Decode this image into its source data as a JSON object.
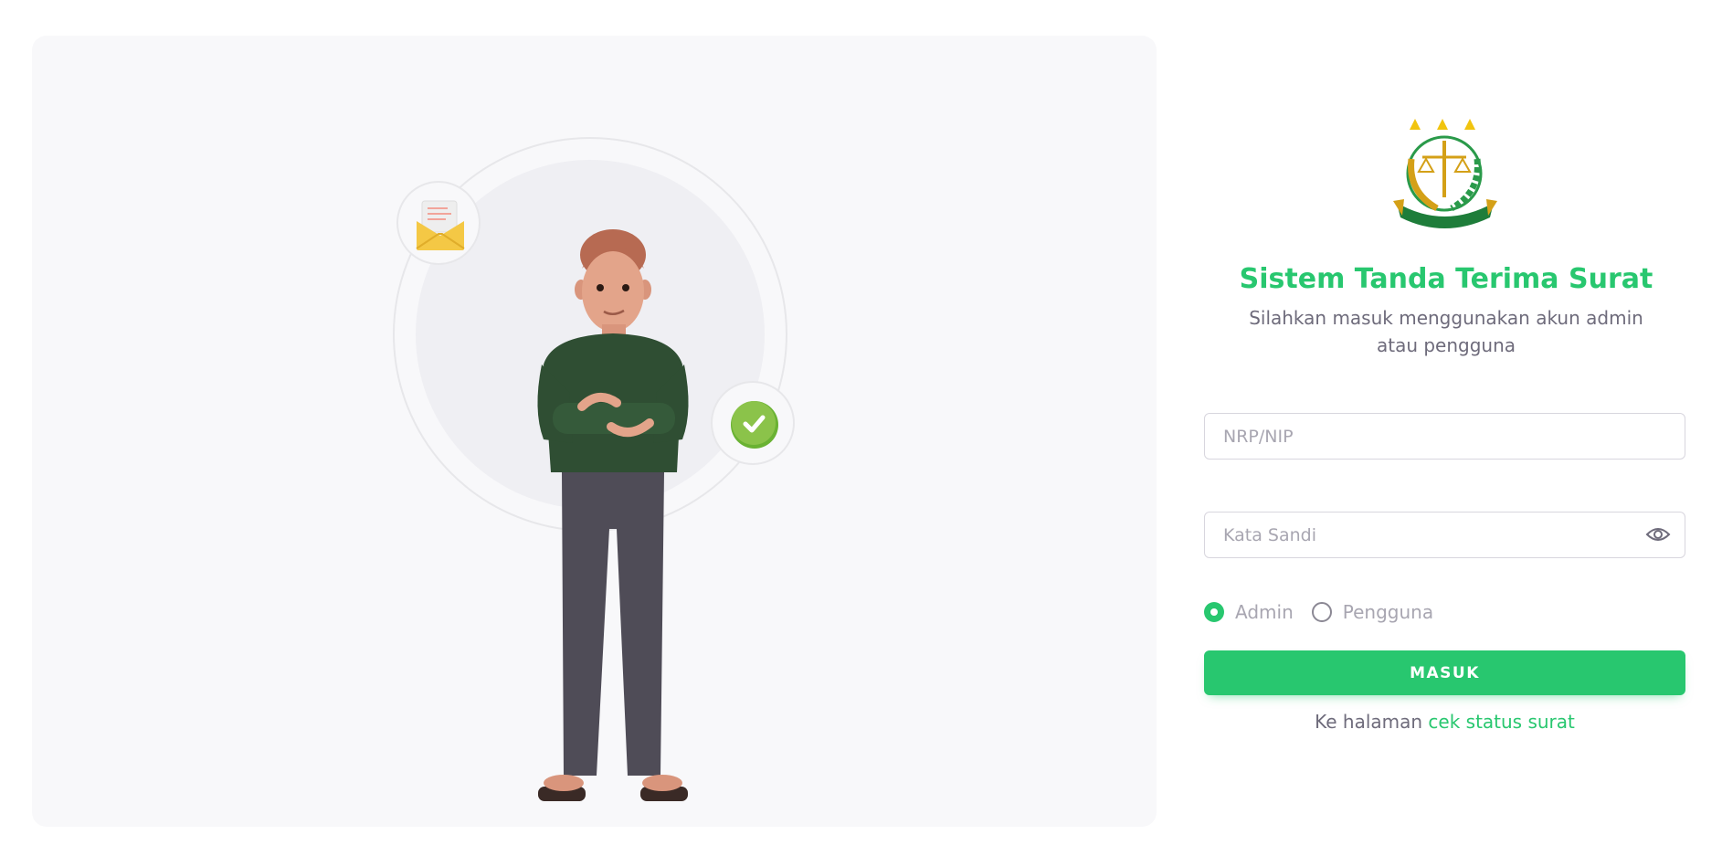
{
  "brand": {
    "accent_color": "#28c76f",
    "logo_icon": "kejaksaan-emblem-icon"
  },
  "login": {
    "title": "Sistem Tanda Terima Surat",
    "subtitle": "Silahkan masuk menggunakan akun admin atau pengguna",
    "username_placeholder": "NRP/NIP",
    "username_value": "",
    "password_placeholder": "Kata Sandi",
    "password_value": "",
    "password_toggle_icon": "eye-icon",
    "roles": [
      {
        "label": "Admin",
        "selected": true
      },
      {
        "label": "Pengguna",
        "selected": false
      }
    ],
    "submit_label": "MASUK",
    "footer_text": "Ke halaman ",
    "footer_link_label": "cek status surat"
  },
  "illustration": {
    "badges": [
      "mail-envelope-icon",
      "check-circle-icon"
    ]
  }
}
